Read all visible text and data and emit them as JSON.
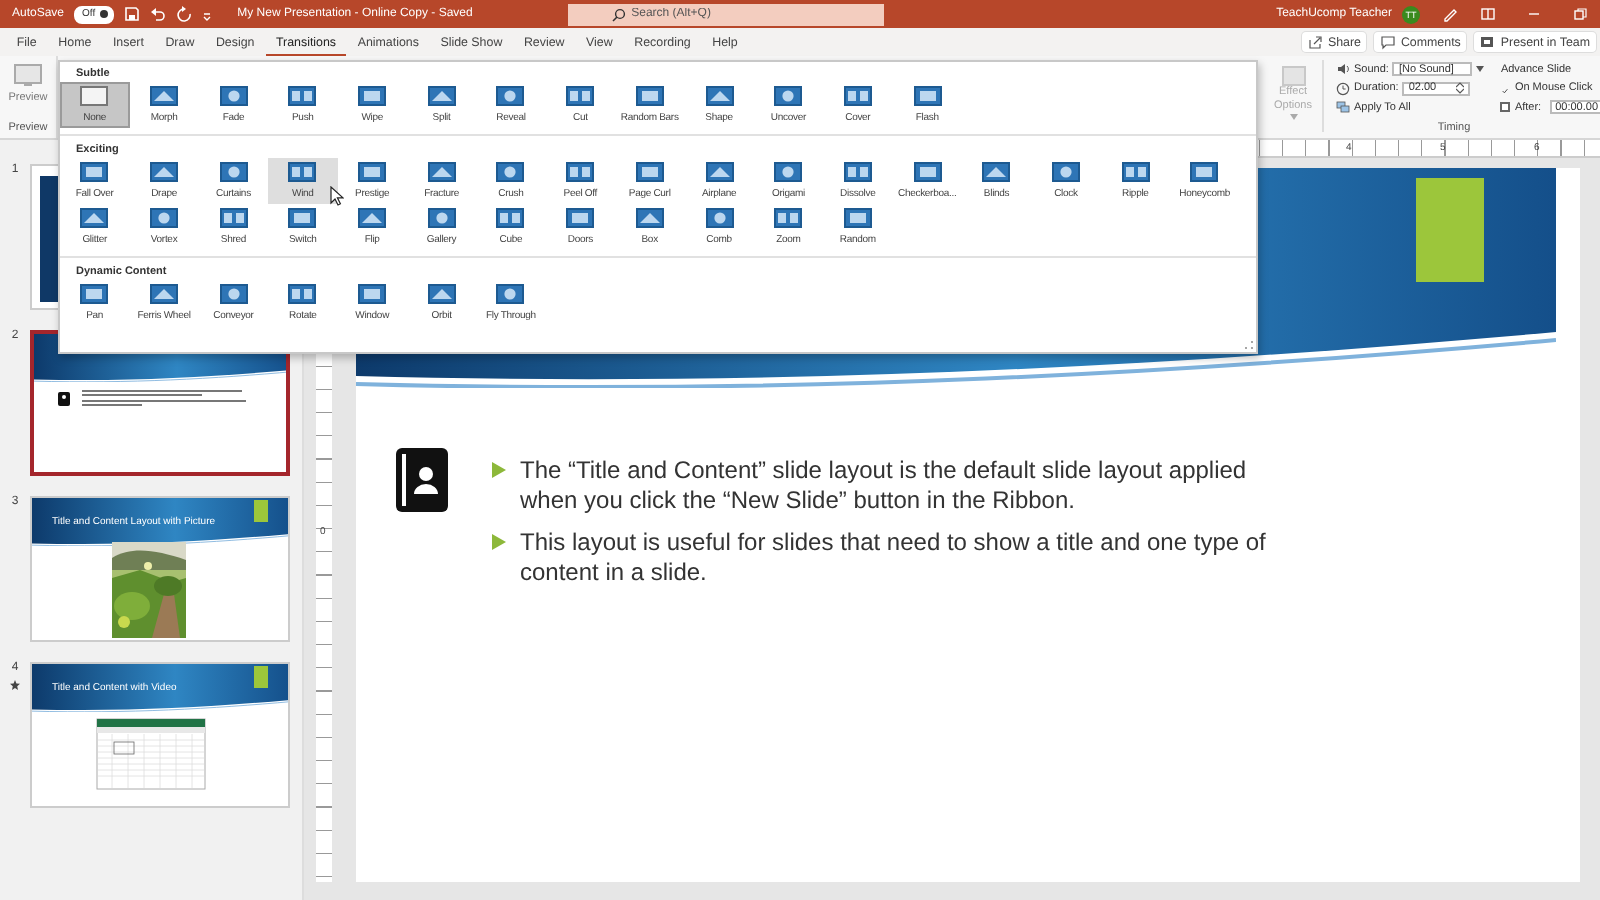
{
  "title_bar": {
    "autosave_label": "AutoSave",
    "autosave_toggle": {
      "label": "Off",
      "on": false
    },
    "document_title": "My New Presentation - Online Copy - Saved",
    "search": {
      "placeholder": "Search (Alt+Q)"
    },
    "user_name": "TeachUcomp Teacher",
    "avatar_initials": "TT"
  },
  "tabs": [
    {
      "label": "File",
      "selected": false
    },
    {
      "label": "Home",
      "selected": false
    },
    {
      "label": "Insert",
      "selected": false
    },
    {
      "label": "Draw",
      "selected": false
    },
    {
      "label": "Design",
      "selected": false
    },
    {
      "label": "Transitions",
      "selected": true
    },
    {
      "label": "Animations",
      "selected": false
    },
    {
      "label": "Slide Show",
      "selected": false
    },
    {
      "label": "Review",
      "selected": false
    },
    {
      "label": "View",
      "selected": false
    },
    {
      "label": "Recording",
      "selected": false
    },
    {
      "label": "Help",
      "selected": false
    }
  ],
  "tab_actions": [
    {
      "kind": "share",
      "label": "Share"
    },
    {
      "kind": "comments",
      "label": "Comments"
    },
    {
      "kind": "present",
      "label": "Present in Team"
    }
  ],
  "ribbon": {
    "preview": {
      "button": "Preview",
      "group": "Preview"
    },
    "effect_options": {
      "label": "Effect Options",
      "disabled": true
    },
    "timing": {
      "sound_label": "Sound:",
      "sound_value": "[No Sound]",
      "duration_label": "Duration:",
      "duration_value": "02.00",
      "apply_all": "Apply To All",
      "advance_title": "Advance Slide",
      "on_mouse_click": {
        "label": "On Mouse Click",
        "checked": true
      },
      "after": {
        "label": "After:",
        "checked": false,
        "value": "00:00.00"
      },
      "group": "Timing"
    }
  },
  "gallery": {
    "sections": [
      {
        "title": "Subtle",
        "items": [
          {
            "label": "None",
            "selected": true,
            "hovered": false
          },
          {
            "label": "Morph",
            "selected": false,
            "hovered": false
          },
          {
            "label": "Fade",
            "selected": false,
            "hovered": false
          },
          {
            "label": "Push",
            "selected": false,
            "hovered": false
          },
          {
            "label": "Wipe",
            "selected": false,
            "hovered": false
          },
          {
            "label": "Split",
            "selected": false,
            "hovered": false
          },
          {
            "label": "Reveal",
            "selected": false,
            "hovered": false
          },
          {
            "label": "Cut",
            "selected": false,
            "hovered": false
          },
          {
            "label": "Random Bars",
            "selected": false,
            "hovered": false
          },
          {
            "label": "Shape",
            "selected": false,
            "hovered": false
          },
          {
            "label": "Uncover",
            "selected": false,
            "hovered": false
          },
          {
            "label": "Cover",
            "selected": false,
            "hovered": false
          },
          {
            "label": "Flash",
            "selected": false,
            "hovered": false
          }
        ]
      },
      {
        "title": "Exciting",
        "items": [
          {
            "label": "Fall Over",
            "selected": false,
            "hovered": false
          },
          {
            "label": "Drape",
            "selected": false,
            "hovered": false
          },
          {
            "label": "Curtains",
            "selected": false,
            "hovered": false
          },
          {
            "label": "Wind",
            "selected": false,
            "hovered": true
          },
          {
            "label": "Prestige",
            "selected": false,
            "hovered": false
          },
          {
            "label": "Fracture",
            "selected": false,
            "hovered": false
          },
          {
            "label": "Crush",
            "selected": false,
            "hovered": false
          },
          {
            "label": "Peel Off",
            "selected": false,
            "hovered": false
          },
          {
            "label": "Page Curl",
            "selected": false,
            "hovered": false
          },
          {
            "label": "Airplane",
            "selected": false,
            "hovered": false
          },
          {
            "label": "Origami",
            "selected": false,
            "hovered": false
          },
          {
            "label": "Dissolve",
            "selected": false,
            "hovered": false
          },
          {
            "label": "Checkerboa...",
            "selected": false,
            "hovered": false
          },
          {
            "label": "Blinds",
            "selected": false,
            "hovered": false
          },
          {
            "label": "Clock",
            "selected": false,
            "hovered": false
          },
          {
            "label": "Ripple",
            "selected": false,
            "hovered": false
          },
          {
            "label": "Honeycomb",
            "selected": false,
            "hovered": false
          },
          {
            "label": "Glitter",
            "selected": false,
            "hovered": false
          },
          {
            "label": "Vortex",
            "selected": false,
            "hovered": false
          },
          {
            "label": "Shred",
            "selected": false,
            "hovered": false
          },
          {
            "label": "Switch",
            "selected": false,
            "hovered": false
          },
          {
            "label": "Flip",
            "selected": false,
            "hovered": false
          },
          {
            "label": "Gallery",
            "selected": false,
            "hovered": false
          },
          {
            "label": "Cube",
            "selected": false,
            "hovered": false
          },
          {
            "label": "Doors",
            "selected": false,
            "hovered": false
          },
          {
            "label": "Box",
            "selected": false,
            "hovered": false
          },
          {
            "label": "Comb",
            "selected": false,
            "hovered": false
          },
          {
            "label": "Zoom",
            "selected": false,
            "hovered": false
          },
          {
            "label": "Random",
            "selected": false,
            "hovered": false
          }
        ]
      },
      {
        "title": "Dynamic Content",
        "items": [
          {
            "label": "Pan",
            "selected": false,
            "hovered": false
          },
          {
            "label": "Ferris Wheel",
            "selected": false,
            "hovered": false
          },
          {
            "label": "Conveyor",
            "selected": false,
            "hovered": false
          },
          {
            "label": "Rotate",
            "selected": false,
            "hovered": false
          },
          {
            "label": "Window",
            "selected": false,
            "hovered": false
          },
          {
            "label": "Orbit",
            "selected": false,
            "hovered": false
          },
          {
            "label": "Fly Through",
            "selected": false,
            "hovered": false
          }
        ]
      }
    ]
  },
  "rulers": {
    "horizontal": [
      "4",
      "5",
      "6"
    ],
    "vertical": [
      "0"
    ]
  },
  "slides": [
    {
      "number": "1",
      "kind": "title",
      "selected": false,
      "has_animation": false
    },
    {
      "number": "2",
      "kind": "content",
      "selected": true,
      "has_animation": false
    },
    {
      "number": "3",
      "kind": "picture",
      "title": "Title and Content Layout with Picture",
      "selected": false,
      "has_animation": false
    },
    {
      "number": "4",
      "kind": "video",
      "title": "Title and Content with Video",
      "selected": false,
      "has_animation": true
    }
  ],
  "slide": {
    "bullets": [
      "The “Title and Content” slide layout is the default slide layout applied when you click the “New Slide” button in the Ribbon.",
      "This layout is useful for slides that need to show a title and one type of content in a slide."
    ]
  }
}
